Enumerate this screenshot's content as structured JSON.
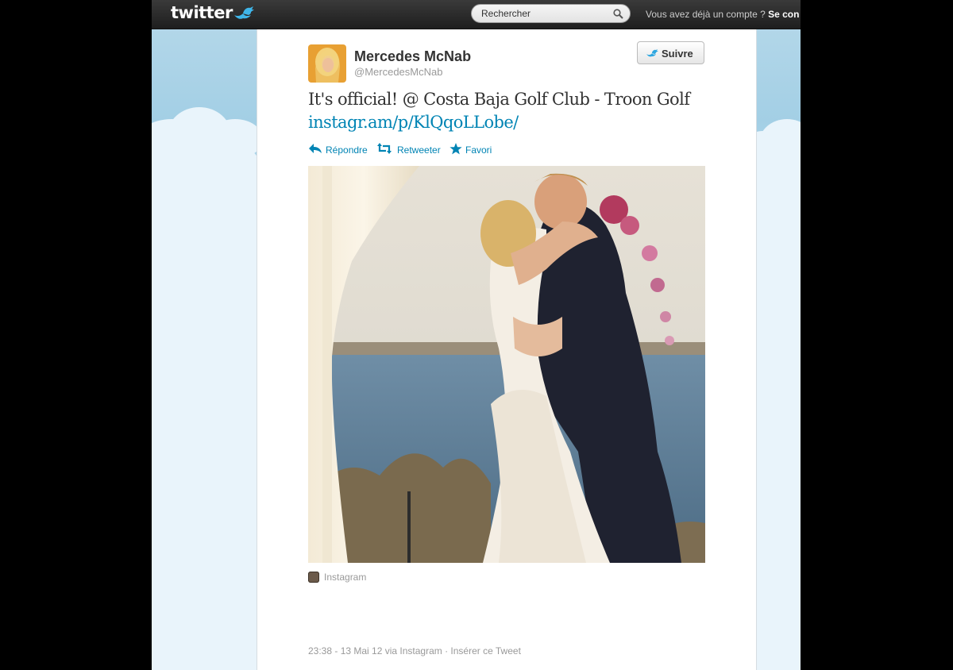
{
  "topbar": {
    "logo_text": "twitter",
    "search_placeholder": "Rechercher",
    "login_prompt": "Vous avez déjà un compte ?",
    "login_link": "Se con"
  },
  "tweet": {
    "author_name": "Mercedes McNab",
    "author_handle": "@MercedesMcNab",
    "follow_label": "Suivre",
    "text": "It's official! @ Costa Baja Golf Club - Troon Golf",
    "link": "instagr.am/p/KlQqoLLobe/",
    "actions": {
      "reply": "Répondre",
      "retweet": "Retweeter",
      "favorite": "Favori"
    },
    "photo_source": "Instagram",
    "meta": "23:38 - 13 Mai 12 via Instagram · Insérer ce Tweet"
  },
  "colors": {
    "link": "#0084b4",
    "topbar": "#2a2a2a",
    "background_sky": "#a3cfe5"
  }
}
